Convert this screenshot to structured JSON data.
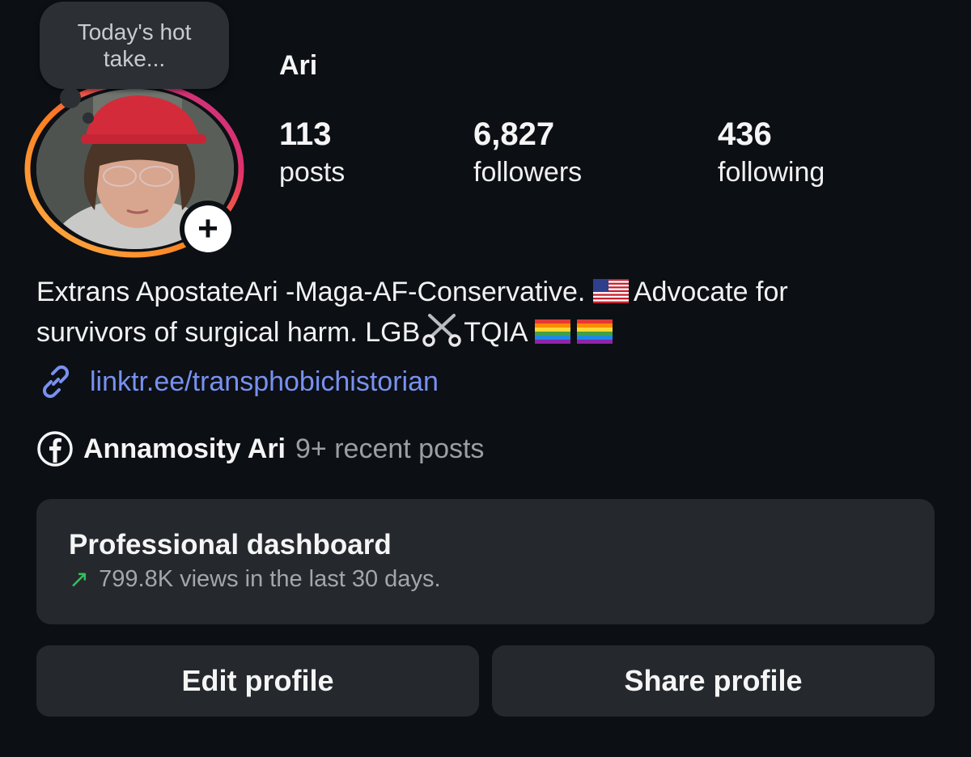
{
  "profile": {
    "note_text": "Today's hot take...",
    "username": "Ari",
    "stats": {
      "posts_count": "113",
      "posts_label": "posts",
      "followers_count": "6,827",
      "followers_label": "followers",
      "following_count": "436",
      "following_label": "following"
    },
    "bio": {
      "line1_before_flag": "Extrans ApostateAri -Maga-AF-Conservative. ",
      "line1_after_flag": "Advocate for",
      "line2_before_scissors": "survivors of surgical harm. LGB",
      "line2_after_scissors": "TQIA"
    },
    "link": "linktr.ee/transphobichistorian",
    "facebook": {
      "name": "Annamosity Ari",
      "recent": "9+ recent posts"
    }
  },
  "dashboard": {
    "title": "Professional dashboard",
    "subtitle": "799.8K views in the last 30 days."
  },
  "buttons": {
    "edit": "Edit profile",
    "share": "Share profile"
  },
  "icons": {
    "add_story": "plus-icon",
    "link": "link-icon",
    "facebook": "facebook-icon",
    "trend": "trend-up-icon",
    "scissors": "scissors-icon",
    "flag_us": "us-flag-icon",
    "flag_pride": "rainbow-flag-icon"
  },
  "colors": {
    "background": "#0c0f14",
    "card": "#25292e",
    "link": "#7891f0",
    "trend": "#33c05a"
  }
}
